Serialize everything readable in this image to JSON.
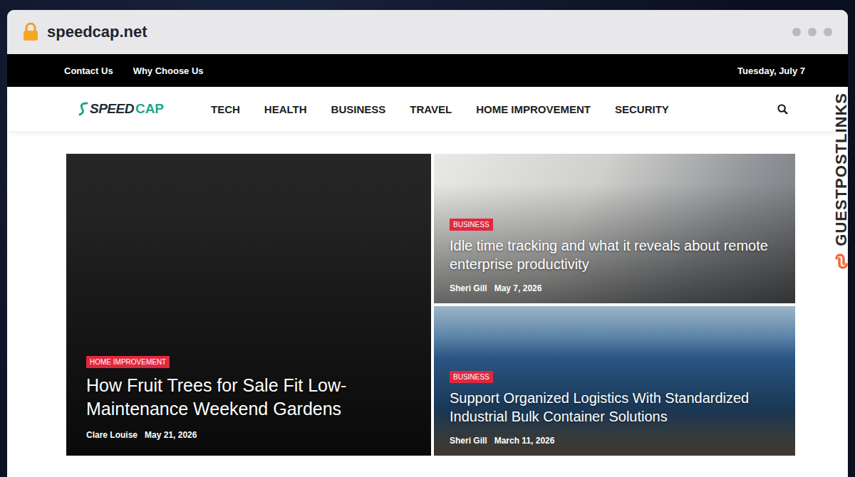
{
  "browser": {
    "url": "speedcap.net",
    "secure": true
  },
  "topbar": {
    "links": [
      "Contact Us",
      "Why Choose Us"
    ],
    "date": "Tuesday, July 7"
  },
  "logo": {
    "text": "SPEED",
    "accent": "CAP"
  },
  "nav": {
    "items": [
      "TECH",
      "HEALTH",
      "BUSINESS",
      "TRAVEL",
      "HOME IMPROVEMENT",
      "SECURITY"
    ]
  },
  "posts": [
    {
      "kind": "dark",
      "category": "HOME IMPROVEMENT",
      "title": "How Fruit Trees for Sale Fit Low-Maintenance Weekend Gardens",
      "author": "Clare Louise",
      "date": "May 21, 2026"
    },
    {
      "kind": "office",
      "category": "BUSINESS",
      "title": "Idle time tracking and what it reveals about remote enterprise productivity",
      "author": "Sheri Gill",
      "date": "May 7, 2026"
    },
    {
      "kind": "containers",
      "category": "BUSINESS",
      "title": "Support Organized Logistics With Standardized Industrial Bulk Container Solutions",
      "author": "Sheri Gill",
      "date": "March 11, 2026"
    }
  ],
  "watermark": "GUESTPOSTLINKS"
}
